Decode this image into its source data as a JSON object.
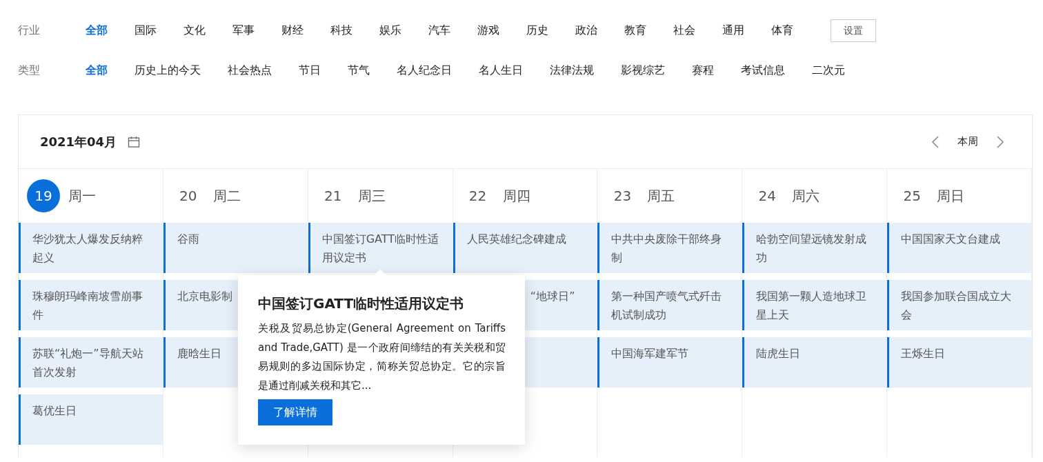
{
  "filters": [
    {
      "label": "行业",
      "options": [
        {
          "label": "全部",
          "selected": true
        },
        {
          "label": "国际",
          "selected": false
        },
        {
          "label": "文化",
          "selected": false
        },
        {
          "label": "军事",
          "selected": false
        },
        {
          "label": "财经",
          "selected": false
        },
        {
          "label": "科技",
          "selected": false
        },
        {
          "label": "娱乐",
          "selected": false
        },
        {
          "label": "汽车",
          "selected": false
        },
        {
          "label": "游戏",
          "selected": false
        },
        {
          "label": "历史",
          "selected": false
        },
        {
          "label": "政治",
          "selected": false
        },
        {
          "label": "教育",
          "selected": false
        },
        {
          "label": "社会",
          "selected": false
        },
        {
          "label": "通用",
          "selected": false
        },
        {
          "label": "体育",
          "selected": false
        }
      ],
      "button": "设置"
    },
    {
      "label": "类型",
      "options": [
        {
          "label": "全部",
          "selected": true
        },
        {
          "label": "历史上的今天",
          "selected": false
        },
        {
          "label": "社会热点",
          "selected": false
        },
        {
          "label": "节日",
          "selected": false
        },
        {
          "label": "节气",
          "selected": false
        },
        {
          "label": "名人纪念日",
          "selected": false
        },
        {
          "label": "名人生日",
          "selected": false
        },
        {
          "label": "法律法规",
          "selected": false
        },
        {
          "label": "影视综艺",
          "selected": false
        },
        {
          "label": "赛程",
          "selected": false
        },
        {
          "label": "考试信息",
          "selected": false
        },
        {
          "label": "二次元",
          "selected": false
        }
      ]
    }
  ],
  "calendar": {
    "month": "2021年04月",
    "this_week": "本周",
    "days": [
      {
        "date": "19",
        "weekday": "周一",
        "selected": true,
        "events": [
          {
            "text": "华沙犹太人爆发反纳粹起义"
          },
          {
            "text": "珠穆朗玛峰南坡雪崩事件"
          },
          {
            "text": "苏联“礼炮一”导航天站首次发射"
          },
          {
            "text": "葛优生日"
          }
        ]
      },
      {
        "date": "20",
        "weekday": "周二",
        "selected": false,
        "events": [
          {
            "text": "谷雨"
          },
          {
            "text": "北京电影制"
          },
          {
            "text": "鹿晗生日"
          }
        ]
      },
      {
        "date": "21",
        "weekday": "周三",
        "selected": false,
        "events": [
          {
            "text": "中国签订GATT临时性适用议定书"
          }
        ]
      },
      {
        "date": "22",
        "weekday": "周四",
        "selected": false,
        "events": [
          {
            "kind": "text",
            "text": "人民英雄纪念碑建成"
          },
          {
            "kind": "text",
            "text": "“地球日”",
            "covered": true
          },
          {
            "kind": "blank"
          }
        ]
      },
      {
        "date": "23",
        "weekday": "周五",
        "selected": false,
        "events": [
          {
            "text": "中共中央废除干部终身制"
          },
          {
            "text": "第一种国产喷气式歼击机试制成功"
          },
          {
            "text": "中国海军建军节"
          }
        ]
      },
      {
        "date": "24",
        "weekday": "周六",
        "selected": false,
        "events": [
          {
            "text": "哈勃空间望远镜发射成功"
          },
          {
            "text": "我国第一颗人造地球卫星上天"
          },
          {
            "text": "陆虎生日"
          }
        ]
      },
      {
        "date": "25",
        "weekday": "周日",
        "selected": false,
        "events": [
          {
            "text": "中国国家天文台建成"
          },
          {
            "text": "我国参加联合国成立大会"
          },
          {
            "text": "王烁生日"
          }
        ]
      }
    ],
    "popover": {
      "title": "中国签订GATT临时性适用议定书",
      "body": "关税及贸易总协定(General Agreement on Tariffs and Trade,GATT) 是一个政府间缔结的有关关税和贸易规则的多边国际协定，简称关贸总协定。它的宗旨是通过削减关税和其它...",
      "button": "了解详情"
    }
  }
}
